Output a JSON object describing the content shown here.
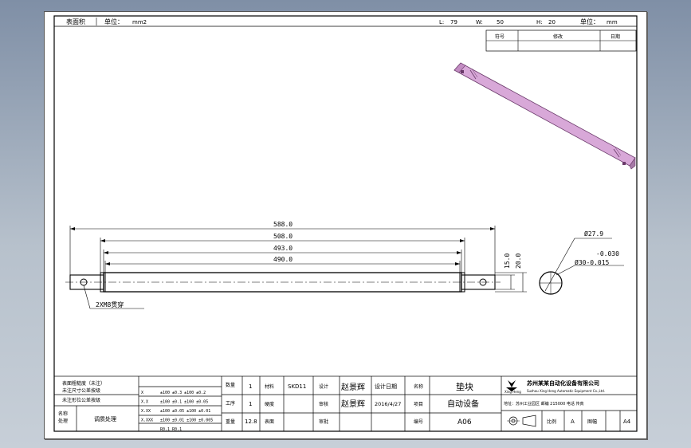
{
  "header": {
    "area_label": "表面积",
    "unit_label_1": "单位：",
    "unit_value_1": "mm2",
    "l_label": "L:",
    "l_value": "79",
    "w_label": "W:",
    "w_value": "50",
    "h_label": "H:",
    "h_value": "20",
    "unit_label_2": "单位：",
    "unit_value_2": "mm"
  },
  "revision_table": {
    "headers": [
      "符号",
      "修改",
      "日期"
    ]
  },
  "dimensions": {
    "d1": "588.0",
    "d2": "508.0",
    "d3": "493.0",
    "d4": "490.0",
    "d5": "15.0",
    "d6": "20.0",
    "dia1": "Ø27.9",
    "tol_upper": "-0.030",
    "dia2": "Ø30-0.015",
    "hole_note": "2XM8贯穿"
  },
  "title_block": {
    "tolerance_rows": [
      "表面粗糙度（未注）",
      "未注尺寸公差按级",
      "未注形位公差按级"
    ],
    "tolerance_table": [
      {
        "key": "X",
        "val": "±100 ±0.3 ±100 ±0.2"
      },
      {
        "key": "X.X",
        "val": "±100 ±0.1 ±100 ±0.05"
      },
      {
        "key": "X.XX",
        "val": "±100 ±0.05 ±100 ±0.01"
      },
      {
        "key": "X.XXX",
        "val": "±100 ±0.01 ±100 ±0.005"
      },
      {
        "key": "",
        "val": "R0.1   R0.1"
      }
    ],
    "left_label": "名称\n处理",
    "left_value": "调质处理",
    "qty_label": "数量",
    "qty_value": "1",
    "material_label": "材料",
    "material_value": "SKD11",
    "process_label": "工序",
    "process_value": "1",
    "hardness_label": "硬度",
    "weight_label": "重量",
    "weight_value": "12.8",
    "surface_label": "表面",
    "designer_label": "设计",
    "designer_value": "赵景辉",
    "date_label": "设计日期",
    "checker_label": "审核",
    "checker_value": "赵景辉",
    "date_value": "2016/4/27",
    "approve_label": "审批",
    "name_label": "名称",
    "name_value": "垫块",
    "project_label": "项目",
    "project_value": "自动设备",
    "code_label": "编号",
    "code_value": "A06",
    "company_cn": "苏州某某自动化设备有限公司",
    "company_en": "Suzhou Xing Heng Automatic Equipment Co.,Ltd.",
    "logo_text": "Xing Heng",
    "address": "地址：苏州工业园区 邮编 215000 电话 传真",
    "scale_label": "比例",
    "scale_value": "A",
    "sheet_label": "图幅",
    "sheet_value": "A4"
  }
}
